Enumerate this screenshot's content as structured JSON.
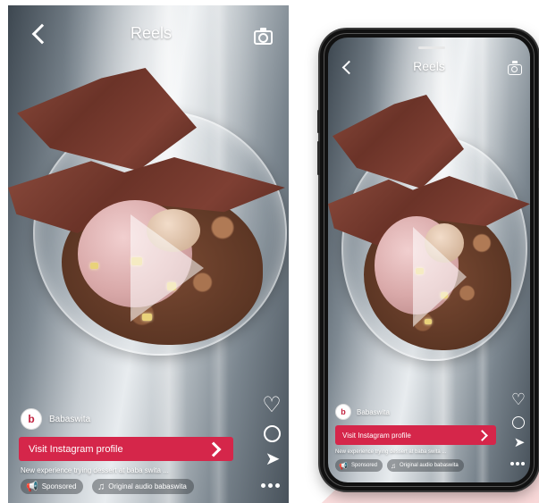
{
  "header": {
    "title": "Reels"
  },
  "profile": {
    "name": "Babaswita",
    "avatar_text": "b"
  },
  "visit_button": {
    "label": "Visit Instagram profile"
  },
  "caption": {
    "text": "New experience trying dessert at baba swita ..."
  },
  "pills": {
    "sponsored": "Sponsored",
    "audio": "Original audio  babaswita"
  },
  "icons": {
    "back": "chevron-left-icon",
    "camera": "camera-icon",
    "like": "heart-icon",
    "comment": "comment-icon",
    "share": "paper-plane-icon",
    "more": "more-dots-icon",
    "sponsored": "megaphone-icon",
    "audio": "music-note-icon",
    "visit": "chevron-right-icon"
  },
  "colors": {
    "accent": "#d5264a",
    "background_pink": "#f9d7d7"
  }
}
